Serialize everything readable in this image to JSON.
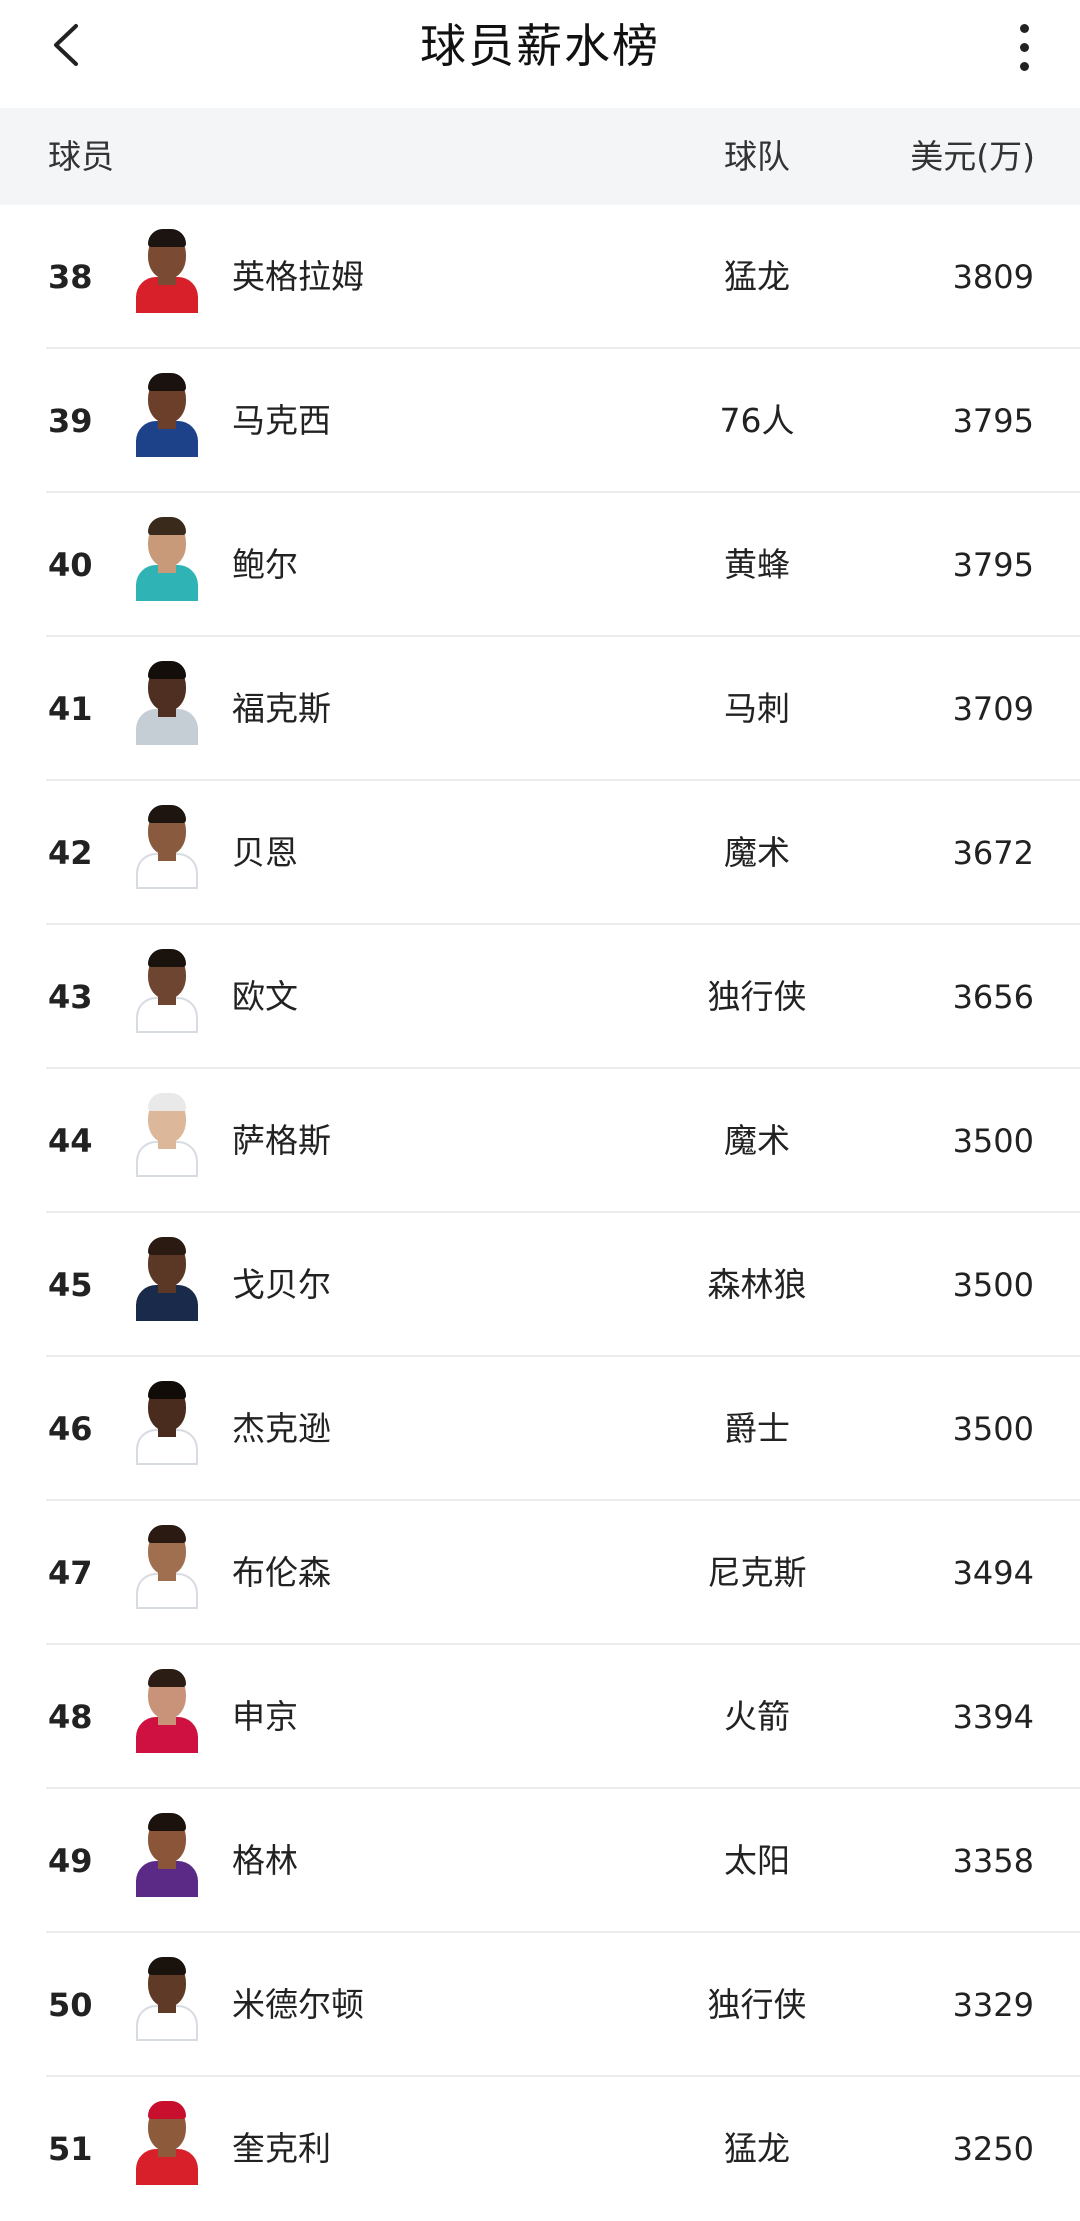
{
  "header": {
    "title": "球员薪水榜",
    "back_icon": "chevron-left-icon",
    "more_icon": "more-vertical-icon"
  },
  "table": {
    "columns": {
      "player": "球员",
      "team": "球队",
      "salary": "美元(万)"
    },
    "rows": [
      {
        "rank": "38",
        "name": "英格拉姆",
        "team": "猛龙",
        "salary": "3809",
        "skin": "#7a4a32",
        "jersey": "#d8202a",
        "hair": "#1b1410"
      },
      {
        "rank": "39",
        "name": "马克西",
        "team": "76人",
        "salary": "3795",
        "skin": "#6b3f2a",
        "jersey": "#1d428a",
        "hair": "#1a120e"
      },
      {
        "rank": "40",
        "name": "鲍尔",
        "team": "黄蜂",
        "salary": "3795",
        "skin": "#c99a7a",
        "jersey": "#2fb3b5",
        "hair": "#3a2a1c"
      },
      {
        "rank": "41",
        "name": "福克斯",
        "team": "马刺",
        "salary": "3709",
        "skin": "#4e2f21",
        "jersey": "#c4ced4",
        "hair": "#140e0a"
      },
      {
        "rank": "42",
        "name": "贝恩",
        "team": "魔术",
        "salary": "3672",
        "skin": "#8a5a3e",
        "jersey": "#ffffff",
        "hair": "#1e1510"
      },
      {
        "rank": "43",
        "name": "欧文",
        "team": "独行侠",
        "salary": "3656",
        "skin": "#6e4530",
        "jersey": "#ffffff",
        "hair": "#1a120d"
      },
      {
        "rank": "44",
        "name": "萨格斯",
        "team": "魔术",
        "salary": "3500",
        "skin": "#dcb79a",
        "jersey": "#ffffff",
        "hair": "#e9e9e9"
      },
      {
        "rank": "45",
        "name": "戈贝尔",
        "team": "森林狼",
        "salary": "3500",
        "skin": "#5b3826",
        "jersey": "#1a2a4a",
        "hair": "#2a1a12"
      },
      {
        "rank": "46",
        "name": "杰克逊",
        "team": "爵士",
        "salary": "3500",
        "skin": "#4a2c1e",
        "jersey": "#ffffff",
        "hair": "#120c09"
      },
      {
        "rank": "47",
        "name": "布伦森",
        "team": "尼克斯",
        "salary": "3494",
        "skin": "#a06f50",
        "jersey": "#ffffff",
        "hair": "#2a1a12"
      },
      {
        "rank": "48",
        "name": "申京",
        "team": "火箭",
        "salary": "3394",
        "skin": "#c9937a",
        "jersey": "#ce1141",
        "hair": "#2b1d14"
      },
      {
        "rank": "49",
        "name": "格林",
        "team": "太阳",
        "salary": "3358",
        "skin": "#8a5538",
        "jersey": "#5b2a86",
        "hair": "#1b120d"
      },
      {
        "rank": "50",
        "name": "米德尔顿",
        "team": "独行侠",
        "salary": "3329",
        "skin": "#5e3a27",
        "jersey": "#ffffff",
        "hair": "#1a120d"
      },
      {
        "rank": "51",
        "name": "奎克利",
        "team": "猛龙",
        "salary": "3250",
        "skin": "#8e5a3c",
        "jersey": "#d8202a",
        "hair": "#c8102e"
      }
    ]
  }
}
